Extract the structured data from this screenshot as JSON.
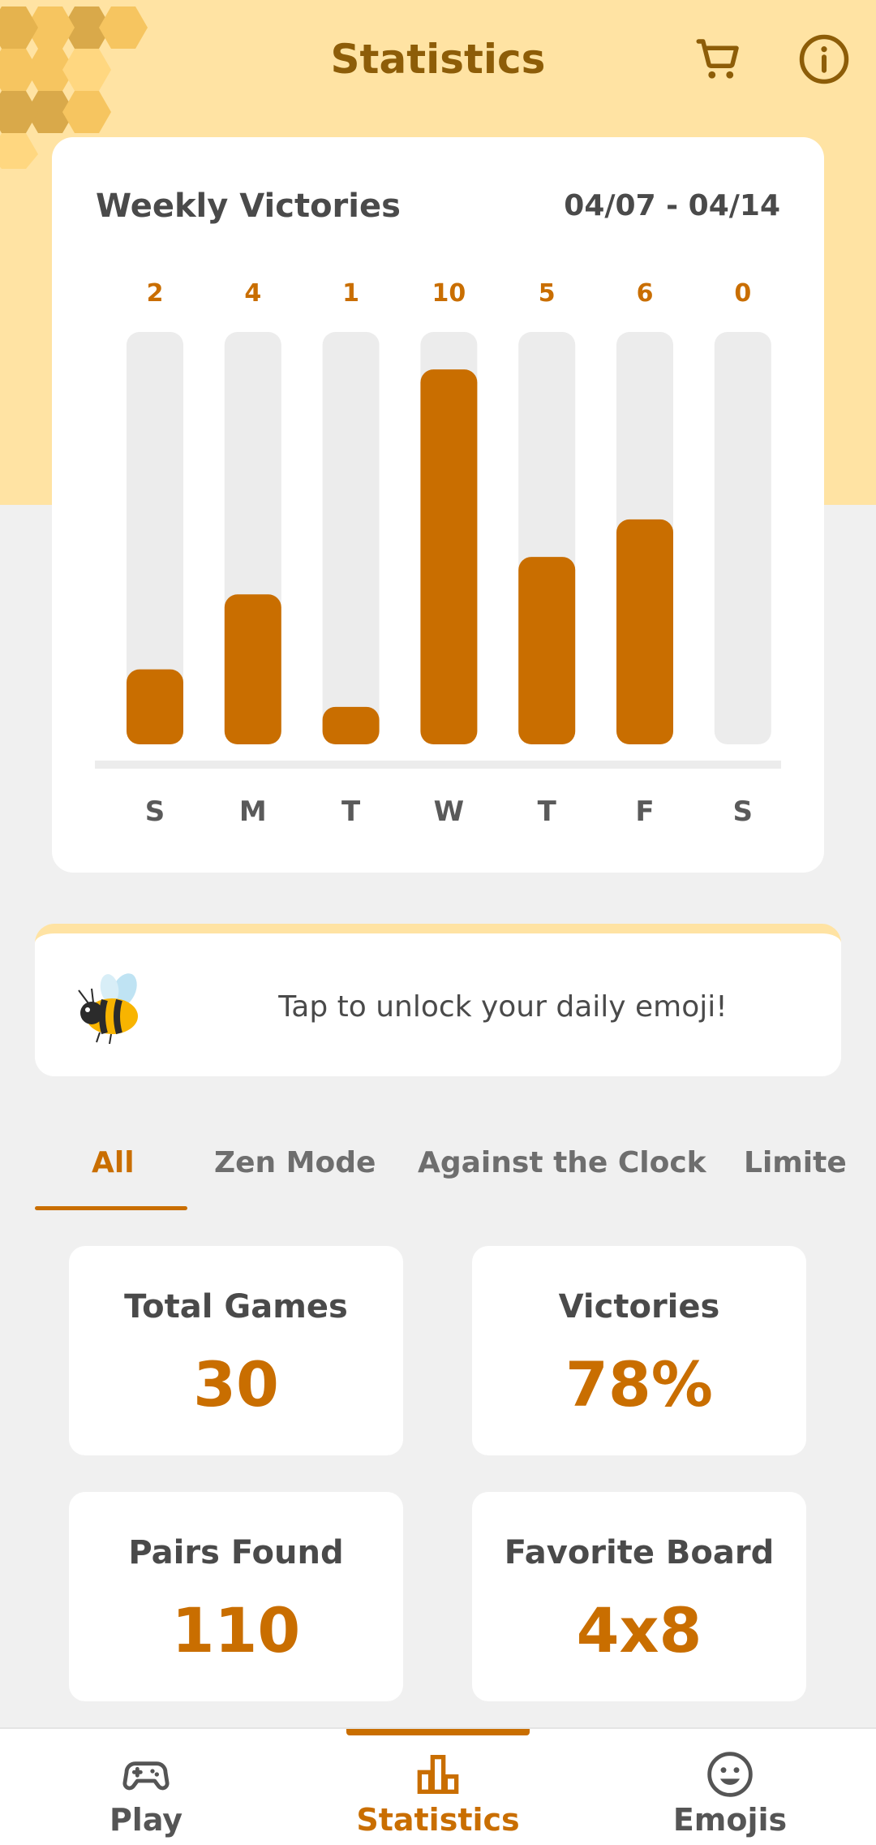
{
  "header": {
    "title": "Statistics",
    "cart_icon": "cart-icon",
    "info_icon": "info-icon"
  },
  "weekly_card": {
    "title": "Weekly Victories",
    "date_range": "04/07 - 04/14"
  },
  "chart_data": {
    "type": "bar",
    "categories": [
      "S",
      "M",
      "T",
      "W",
      "T",
      "F",
      "S"
    ],
    "values": [
      2,
      4,
      1,
      10,
      5,
      6,
      0
    ],
    "ylim": [
      0,
      11
    ],
    "data_labels": [
      "2",
      "4",
      "1",
      "10",
      "5",
      "6",
      "0"
    ],
    "colors": {
      "bar": "#c96e00",
      "track": "#ececec",
      "label": "#c96e00"
    }
  },
  "emoji_banner": {
    "icon": "bee-icon",
    "text": "Tap to unlock your daily emoji!"
  },
  "tabs": [
    {
      "label": "All",
      "active": true
    },
    {
      "label": "Zen Mode",
      "active": false
    },
    {
      "label": "Against the Clock",
      "active": false
    },
    {
      "label": "Limite",
      "active": false
    }
  ],
  "stats": {
    "total_games": {
      "label": "Total Games",
      "value": "30"
    },
    "victories": {
      "label": "Victories",
      "value": "78%"
    },
    "pairs_found": {
      "label": "Pairs Found",
      "value": "110"
    },
    "favorite_board": {
      "label": "Favorite Board",
      "value": "4x8"
    }
  },
  "bottom_nav": {
    "play": {
      "label": "Play",
      "icon": "gamepad-icon"
    },
    "statistics": {
      "label": "Statistics",
      "icon": "bar-chart-icon",
      "active": true
    },
    "emojis": {
      "label": "Emojis",
      "icon": "smiley-icon"
    }
  },
  "colors": {
    "accent": "#c96e00",
    "header_bg": "#ffe3a3",
    "title": "#8d5d08"
  }
}
